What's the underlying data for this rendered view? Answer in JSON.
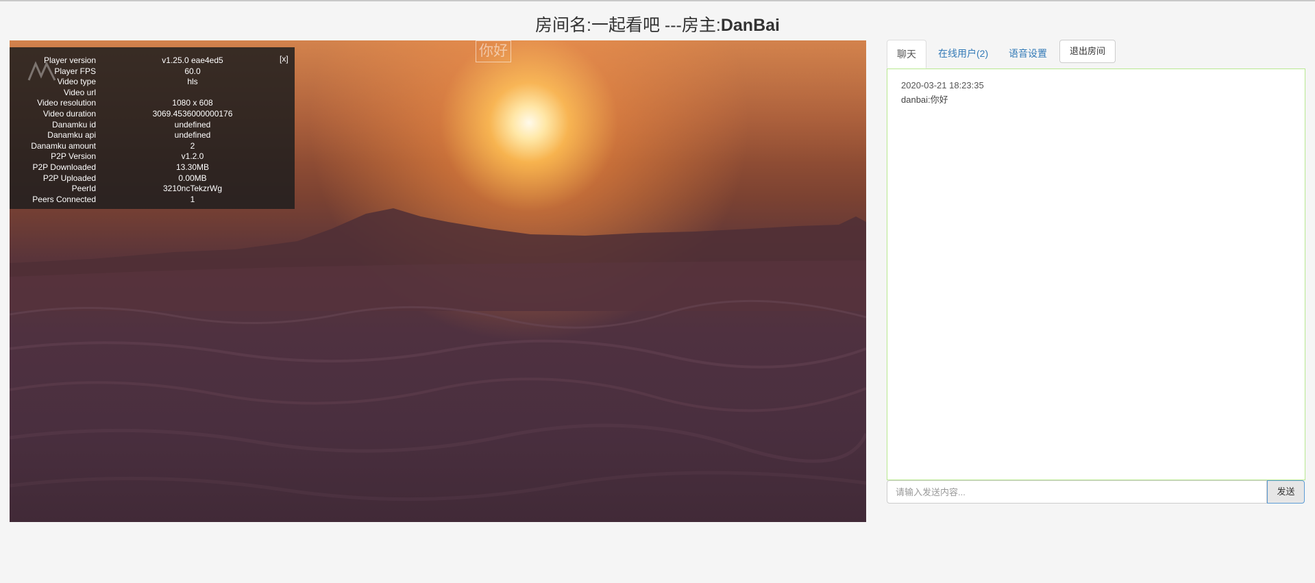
{
  "header": {
    "room_label": "房间名:一起看吧 ---房主:",
    "host_name": "DanBai"
  },
  "player": {
    "danmaku_text": "你好",
    "close_label": "[x]",
    "info": [
      {
        "key": "Player version",
        "value": "v1.25.0 eae4ed5"
      },
      {
        "key": "Player FPS",
        "value": "60.0"
      },
      {
        "key": "Video type",
        "value": "hls"
      },
      {
        "key": "Video url",
        "value": ""
      },
      {
        "key": "Video resolution",
        "value": "1080 x 608"
      },
      {
        "key": "Video duration",
        "value": "3069.4536000000176"
      },
      {
        "key": "Danamku id",
        "value": "undefined"
      },
      {
        "key": "Danamku api",
        "value": "undefined"
      },
      {
        "key": "Danamku amount",
        "value": "2"
      },
      {
        "key": "P2P Version",
        "value": "v1.2.0"
      },
      {
        "key": "P2P Downloaded",
        "value": "13.30MB"
      },
      {
        "key": "P2P Uploaded",
        "value": "0.00MB"
      },
      {
        "key": "PeerId",
        "value": "3210ncTekzrWg"
      },
      {
        "key": "Peers Connected",
        "value": "1"
      }
    ]
  },
  "chat": {
    "tabs": [
      {
        "label": "聊天",
        "active": true
      },
      {
        "label": "在线用户(2)",
        "active": false
      },
      {
        "label": "语音设置",
        "active": false
      }
    ],
    "exit_label": "退出房间",
    "messages": [
      {
        "time": "2020-03-21 18:23:35",
        "text": "danbai:你好"
      }
    ],
    "input_placeholder": "请输入发送内容...",
    "send_label": "发送"
  },
  "colors": {
    "chat_border": "#b7e88f",
    "link": "#337ab7",
    "send_border": "#5b9bd5"
  }
}
